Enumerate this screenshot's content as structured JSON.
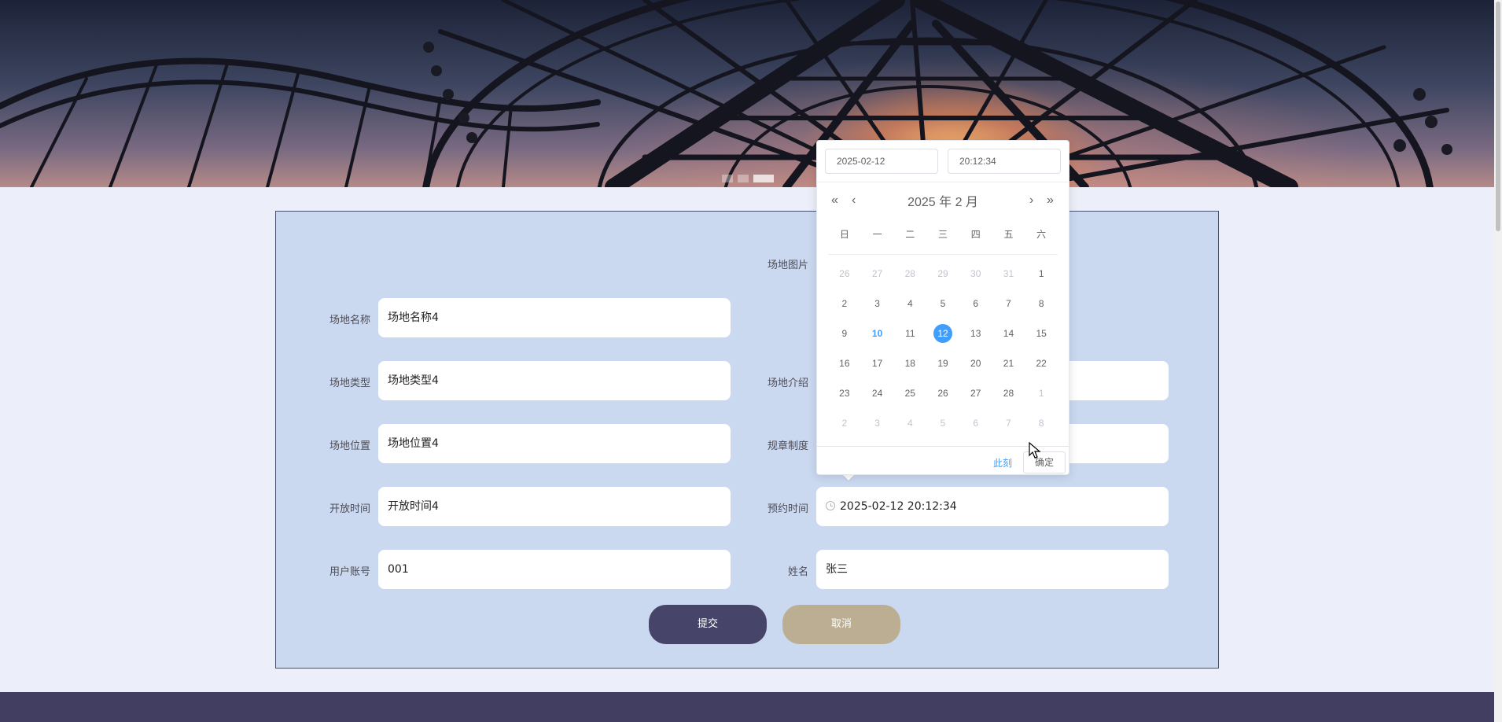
{
  "form": {
    "venue_image_label": "场地图片",
    "name": {
      "label": "场地名称",
      "value": "场地名称4"
    },
    "type": {
      "label": "场地类型",
      "value": "场地类型4"
    },
    "intro": {
      "label": "场地介绍",
      "value": ""
    },
    "location": {
      "label": "场地位置",
      "value": "场地位置4"
    },
    "rules": {
      "label": "规章制度",
      "value": ""
    },
    "open_time": {
      "label": "开放时间",
      "value": "开放时间4"
    },
    "booking_time": {
      "label": "预约时间",
      "value": "2025-02-12 20:12:34"
    },
    "account": {
      "label": "用户账号",
      "value": "001"
    },
    "real_name": {
      "label": "姓名",
      "value": "张三"
    },
    "submit_label": "提交",
    "cancel_label": "取消"
  },
  "date_picker": {
    "date_input": "2025-02-12",
    "time_input": "20:12:34",
    "title": "2025 年  2 月",
    "weekdays": [
      "日",
      "一",
      "二",
      "三",
      "四",
      "五",
      "六"
    ],
    "today": "10",
    "selected": "12",
    "days": [
      [
        {
          "d": "26",
          "m": "prev"
        },
        {
          "d": "27",
          "m": "prev"
        },
        {
          "d": "28",
          "m": "prev"
        },
        {
          "d": "29",
          "m": "prev"
        },
        {
          "d": "30",
          "m": "prev"
        },
        {
          "d": "31",
          "m": "prev"
        },
        {
          "d": "1",
          "m": "cur"
        }
      ],
      [
        {
          "d": "2",
          "m": "cur"
        },
        {
          "d": "3",
          "m": "cur"
        },
        {
          "d": "4",
          "m": "cur"
        },
        {
          "d": "5",
          "m": "cur"
        },
        {
          "d": "6",
          "m": "cur"
        },
        {
          "d": "7",
          "m": "cur"
        },
        {
          "d": "8",
          "m": "cur"
        }
      ],
      [
        {
          "d": "9",
          "m": "cur"
        },
        {
          "d": "10",
          "m": "cur"
        },
        {
          "d": "11",
          "m": "cur"
        },
        {
          "d": "12",
          "m": "cur"
        },
        {
          "d": "13",
          "m": "cur"
        },
        {
          "d": "14",
          "m": "cur"
        },
        {
          "d": "15",
          "m": "cur"
        }
      ],
      [
        {
          "d": "16",
          "m": "cur"
        },
        {
          "d": "17",
          "m": "cur"
        },
        {
          "d": "18",
          "m": "cur"
        },
        {
          "d": "19",
          "m": "cur"
        },
        {
          "d": "20",
          "m": "cur"
        },
        {
          "d": "21",
          "m": "cur"
        },
        {
          "d": "22",
          "m": "cur"
        }
      ],
      [
        {
          "d": "23",
          "m": "cur"
        },
        {
          "d": "24",
          "m": "cur"
        },
        {
          "d": "25",
          "m": "cur"
        },
        {
          "d": "26",
          "m": "cur"
        },
        {
          "d": "27",
          "m": "cur"
        },
        {
          "d": "28",
          "m": "cur"
        },
        {
          "d": "1",
          "m": "next"
        }
      ],
      [
        {
          "d": "2",
          "m": "next"
        },
        {
          "d": "3",
          "m": "next"
        },
        {
          "d": "4",
          "m": "next"
        },
        {
          "d": "5",
          "m": "next"
        },
        {
          "d": "6",
          "m": "next"
        },
        {
          "d": "7",
          "m": "next"
        },
        {
          "d": "8",
          "m": "next"
        }
      ]
    ],
    "now_label": "此刻",
    "confirm_label": "确定",
    "nav_prev_year": "«",
    "nav_prev_month": "‹",
    "nav_next_month": "›",
    "nav_next_year": "»"
  },
  "colors": {
    "page_bg": "#eceff9",
    "panel_bg": "#cad8f0",
    "submit_button": "#464569",
    "cancel_button": "#bbae93",
    "footer": "#413e62",
    "accent": "#409eff"
  }
}
